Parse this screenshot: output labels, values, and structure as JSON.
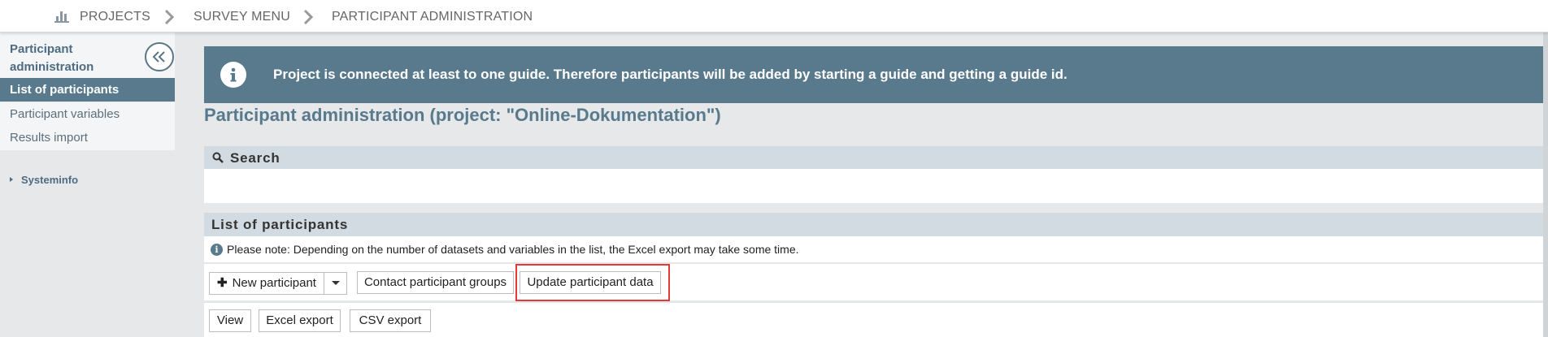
{
  "breadcrumb": {
    "items": [
      "PROJECTS",
      "SURVEY MENU",
      "PARTICIPANT ADMINISTRATION"
    ]
  },
  "sidebar": {
    "title": "Participant administration",
    "items": [
      {
        "label": "List of participants",
        "active": true
      },
      {
        "label": "Participant variables",
        "active": false
      },
      {
        "label": "Results import",
        "active": false
      }
    ],
    "systeminfo": "Systeminfo"
  },
  "info_banner": {
    "text": "Project is connected at least to one guide. Therefore participants will be added by starting a guide and getting a guide id."
  },
  "page_title": "Participant administration (project: \"Online-Dokumentation\")",
  "search_panel": {
    "title": "Search"
  },
  "list_panel": {
    "title": "List of participants",
    "note": "Please note: Depending on the number of datasets and variables in the list, the Excel export may take some time.",
    "buttons": {
      "new_participant": "New participant",
      "contact_groups": "Contact participant groups",
      "update_data": "Update participant data",
      "view": "View",
      "excel_export": "Excel export",
      "csv_export": "CSV export"
    }
  },
  "colors": {
    "accent": "#587a8c",
    "panel_header": "#d3dbe2",
    "highlight": "#e53935"
  }
}
